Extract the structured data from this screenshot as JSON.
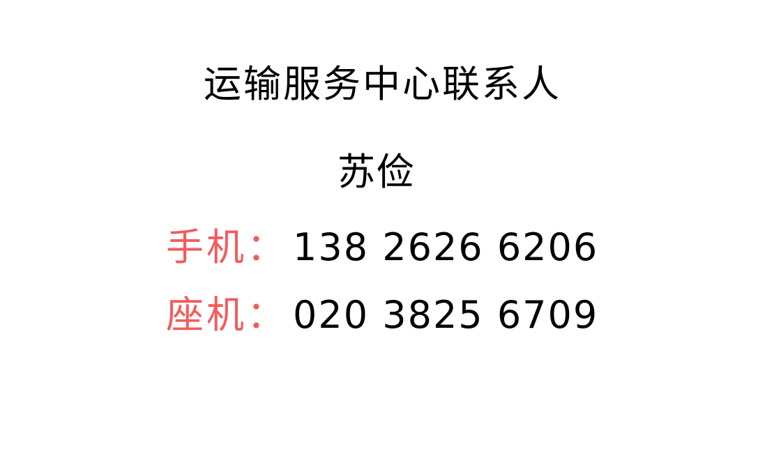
{
  "contact_card": {
    "title": "运输服务中心联系人",
    "name": "苏俭",
    "mobile": {
      "label": "手机：",
      "number": "138 2626 6206"
    },
    "landline": {
      "label": "座机：",
      "number": "020 3825 6709"
    }
  },
  "colors": {
    "label_red": "#f25c5c",
    "text": "#000000",
    "background": "#ffffff"
  }
}
